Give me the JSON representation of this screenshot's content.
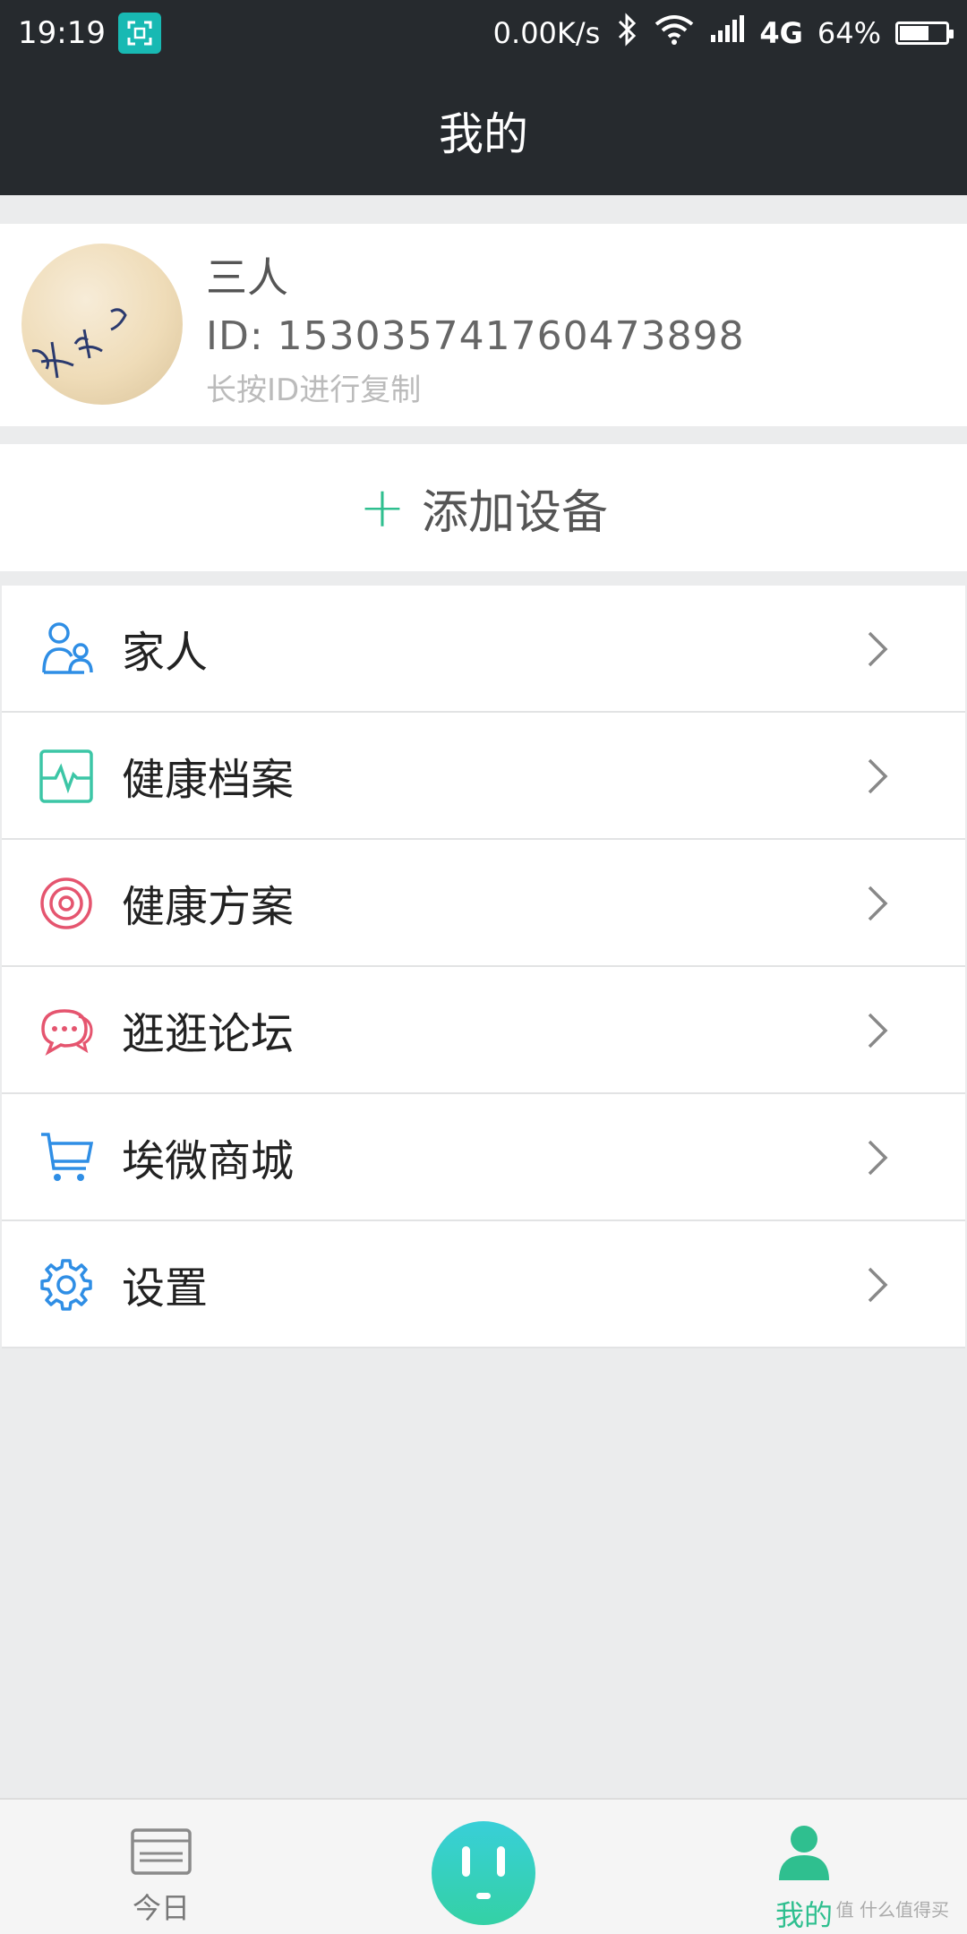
{
  "status_bar": {
    "time": "19:19",
    "network_speed": "0.00K/s",
    "network_type": "4G",
    "battery": "64%",
    "battery_level": 0.64
  },
  "header": {
    "title": "我的"
  },
  "profile": {
    "name": "三人",
    "id": "ID: 15303574176047389​8",
    "hint": "长按ID进行复制"
  },
  "add_device": {
    "plus": "+",
    "label": "添加设备"
  },
  "menu": [
    {
      "label": "家人",
      "icon": "family-icon",
      "color": "#2f8ee5"
    },
    {
      "label": "健康档案",
      "icon": "health-record-icon",
      "color": "#3cc6a6"
    },
    {
      "label": "健康方案",
      "icon": "target-icon",
      "color": "#e5556f"
    },
    {
      "label": "逛逛论坛",
      "icon": "chat-icon",
      "color": "#e5556f"
    },
    {
      "label": "埃微商城",
      "icon": "cart-icon",
      "color": "#2f8ee5"
    },
    {
      "label": "设置",
      "icon": "gear-icon",
      "color": "#2f8ee5"
    }
  ],
  "tab_bar": {
    "today_label": "今日",
    "mine_label": "我的",
    "active_color": "#2fbf8f"
  },
  "watermark": "值 什么值得买"
}
